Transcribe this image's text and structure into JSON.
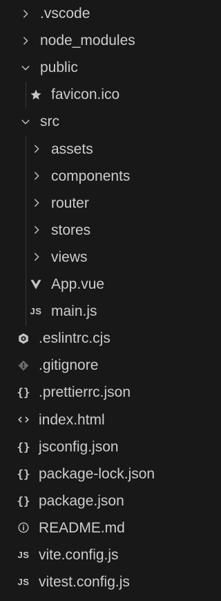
{
  "explorer": {
    "items": [
      {
        "label": ".vscode",
        "kind": "folder",
        "expanded": false,
        "depth": 0
      },
      {
        "label": "node_modules",
        "kind": "folder",
        "expanded": false,
        "depth": 0
      },
      {
        "label": "public",
        "kind": "folder",
        "expanded": true,
        "depth": 0
      },
      {
        "label": "favicon.ico",
        "kind": "file",
        "icon": "star-icon",
        "depth": 1
      },
      {
        "label": "src",
        "kind": "folder",
        "expanded": true,
        "depth": 0
      },
      {
        "label": "assets",
        "kind": "folder",
        "expanded": false,
        "depth": 1
      },
      {
        "label": "components",
        "kind": "folder",
        "expanded": false,
        "depth": 1
      },
      {
        "label": "router",
        "kind": "folder",
        "expanded": false,
        "depth": 1
      },
      {
        "label": "stores",
        "kind": "folder",
        "expanded": false,
        "depth": 1
      },
      {
        "label": "views",
        "kind": "folder",
        "expanded": false,
        "depth": 1
      },
      {
        "label": "App.vue",
        "kind": "file",
        "icon": "vue-icon",
        "depth": 1
      },
      {
        "label": "main.js",
        "kind": "file",
        "icon": "js-icon",
        "depth": 1
      },
      {
        "label": ".eslintrc.cjs",
        "kind": "file",
        "icon": "eslint-icon",
        "depth": 0
      },
      {
        "label": ".gitignore",
        "kind": "file",
        "icon": "git-icon",
        "depth": 0
      },
      {
        "label": ".prettierrc.json",
        "kind": "file",
        "icon": "json-braces-icon",
        "depth": 0
      },
      {
        "label": "index.html",
        "kind": "file",
        "icon": "html-icon",
        "depth": 0
      },
      {
        "label": "jsconfig.json",
        "kind": "file",
        "icon": "json-braces-icon",
        "depth": 0
      },
      {
        "label": "package-lock.json",
        "kind": "file",
        "icon": "json-braces-icon",
        "depth": 0
      },
      {
        "label": "package.json",
        "kind": "file",
        "icon": "json-braces-icon",
        "depth": 0
      },
      {
        "label": "README.md",
        "kind": "file",
        "icon": "info-icon",
        "depth": 0
      },
      {
        "label": "vite.config.js",
        "kind": "file",
        "icon": "js-icon",
        "depth": 0
      },
      {
        "label": "vitest.config.js",
        "kind": "file",
        "icon": "js-icon",
        "depth": 0
      }
    ]
  },
  "icon_text": {
    "js": "JS",
    "braces": "{}"
  },
  "colors": {
    "background": "#181818",
    "text": "#cccccc",
    "icon": "#c5c5c5"
  }
}
